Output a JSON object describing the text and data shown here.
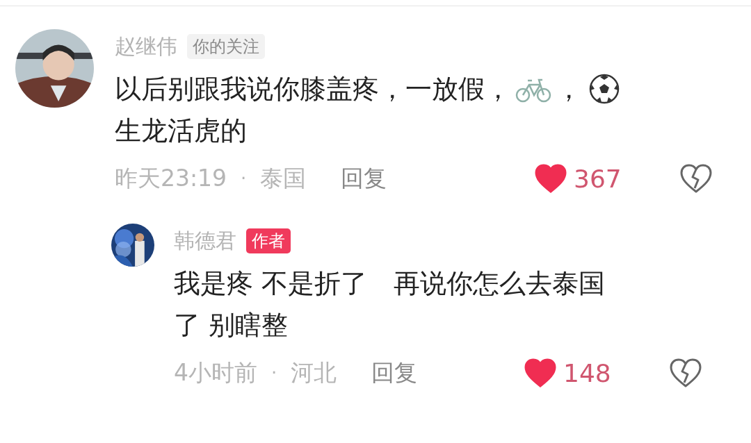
{
  "comments": [
    {
      "author": "赵继伟",
      "tag": {
        "kind": "following",
        "label": "你的关注"
      },
      "avatar": {
        "kind": "picture"
      },
      "reply": false,
      "lines": [
        [
          {
            "kind": "text",
            "text": "以后别跟我说你膝盖疼，一放假，"
          },
          {
            "kind": "bicycle"
          },
          {
            "kind": "text",
            "text": "，"
          },
          {
            "kind": "ball"
          }
        ],
        [
          {
            "kind": "text",
            "text": "生龙活虎的"
          }
        ]
      ],
      "time": "昨天23:19",
      "separator": "·",
      "location": "泰国",
      "reply_label": "回复",
      "liked": true,
      "likes": "367"
    },
    {
      "author": "韩德君",
      "tag": {
        "kind": "author",
        "label": "作者"
      },
      "avatar": {
        "kind": "picture"
      },
      "reply": true,
      "lines": [
        [
          {
            "kind": "text",
            "text": "我是疼 不是折了　再说你怎么去泰国"
          }
        ],
        [
          {
            "kind": "text",
            "text": "了 别瞎整"
          }
        ]
      ],
      "time": "4小时前",
      "separator": "·",
      "location": "河北",
      "reply_label": "回复",
      "liked": true,
      "likes": "148"
    }
  ]
}
